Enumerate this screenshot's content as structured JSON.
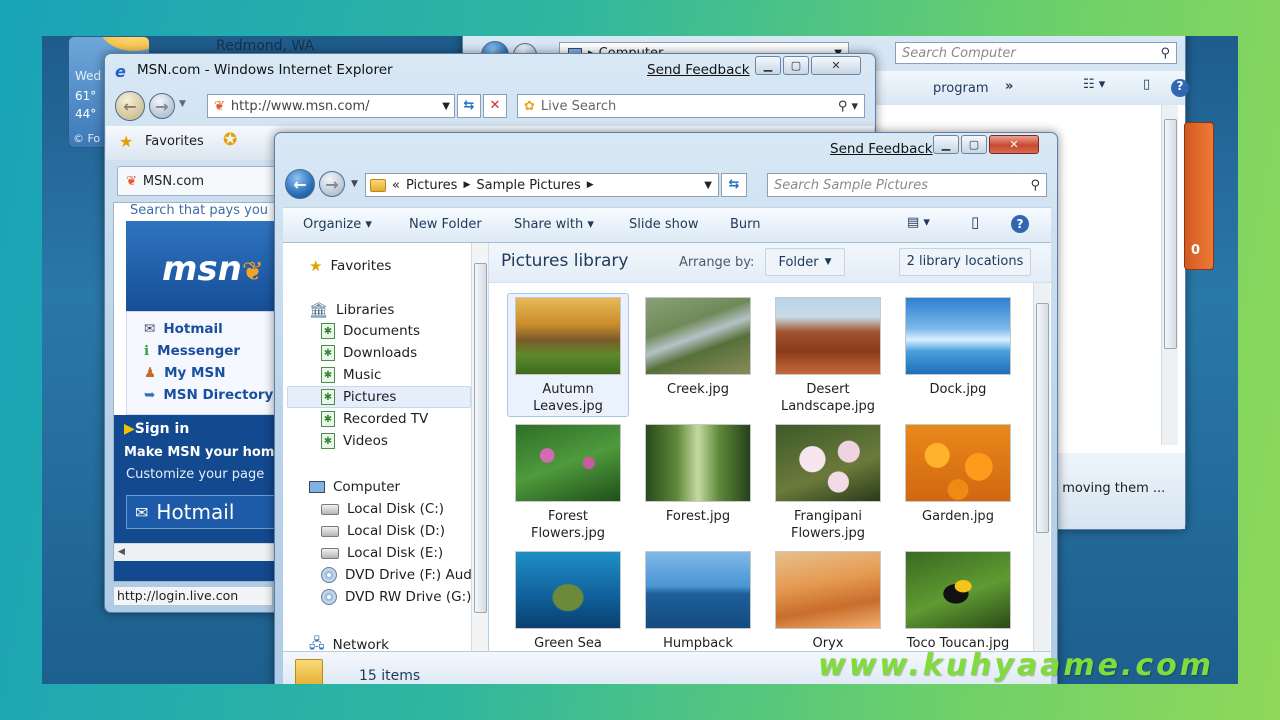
{
  "gadget": {
    "city": "Redmond, WA",
    "day": "Wed",
    "temp_high": "61°",
    "temp_low": "44°",
    "footer": "Fo"
  },
  "computer_window": {
    "breadcrumb": "Computer",
    "search_placeholder": "Search Computer",
    "toolbar_text": "program",
    "status_text": "t moving them ..."
  },
  "red_gadget": {
    "value": "0"
  },
  "ie": {
    "title": "MSN.com - Windows Internet Explorer",
    "send_feedback": "Send Feedback",
    "address": "http://www.msn.com/",
    "search_placeholder": "Live Search",
    "favorites_label": "Favorites",
    "tab_label": "MSN.com",
    "page": {
      "banner": "Search that pays you",
      "logo": "msn",
      "links": [
        "Hotmail",
        "Messenger",
        "My MSN",
        "MSN Directory"
      ],
      "sign_in": "Sign in",
      "make_msn": "Make MSN your hom",
      "customize": "Customize your page",
      "hotmail_big": "Hotmail"
    },
    "status_url": "http://login.live.con"
  },
  "explorer": {
    "send_feedback": "Send Feedback",
    "breadcrumb": {
      "overflow": "«",
      "items": [
        "Pictures",
        "Sample Pictures"
      ]
    },
    "search_placeholder": "Search Sample Pictures",
    "toolbar": {
      "organize": "Organize",
      "new_folder": "New Folder",
      "share_with": "Share with",
      "slide_show": "Slide show",
      "burn": "Burn"
    },
    "sidebar": {
      "favorites": "Favorites",
      "libraries": "Libraries",
      "library_items": [
        "Documents",
        "Downloads",
        "Music",
        "Pictures",
        "Recorded TV",
        "Videos"
      ],
      "computer": "Computer",
      "drives": [
        "Local Disk (C:)",
        "Local Disk (D:)",
        "Local Disk (E:)",
        "DVD Drive (F:) Audio",
        "DVD RW Drive (G:) A"
      ],
      "network": "Network"
    },
    "library_header": {
      "title": "Pictures library",
      "arrange_by": "Arrange by:",
      "arrange_value": "Folder",
      "locations": "2 library locations"
    },
    "files": [
      {
        "name": "Autumn Leaves.jpg",
        "l1": "Autumn",
        "l2": "Leaves.jpg"
      },
      {
        "name": "Creek.jpg",
        "l1": "Creek.jpg",
        "l2": ""
      },
      {
        "name": "Desert Landscape.jpg",
        "l1": "Desert",
        "l2": "Landscape.jpg"
      },
      {
        "name": "Dock.jpg",
        "l1": "Dock.jpg",
        "l2": ""
      },
      {
        "name": "Forest Flowers.jpg",
        "l1": "Forest",
        "l2": "Flowers.jpg"
      },
      {
        "name": "Forest.jpg",
        "l1": "Forest.jpg",
        "l2": ""
      },
      {
        "name": "Frangipani Flowers.jpg",
        "l1": "Frangipani",
        "l2": "Flowers.jpg"
      },
      {
        "name": "Garden.jpg",
        "l1": "Garden.jpg",
        "l2": ""
      },
      {
        "name": "Green Sea",
        "l1": "Green Sea",
        "l2": ""
      },
      {
        "name": "Humpback",
        "l1": "Humpback",
        "l2": ""
      },
      {
        "name": "Oryx",
        "l1": "Oryx",
        "l2": ""
      },
      {
        "name": "Toco Toucan.jpg",
        "l1": "Toco Toucan.jpg",
        "l2": ""
      }
    ],
    "status": "15 items"
  },
  "watermark": "www.kuhyaame.com",
  "colors": {
    "accent": "#1e395b",
    "link": "#1a4f9f",
    "watermark": "#7fdc3a",
    "selection": "#cde4f7"
  }
}
